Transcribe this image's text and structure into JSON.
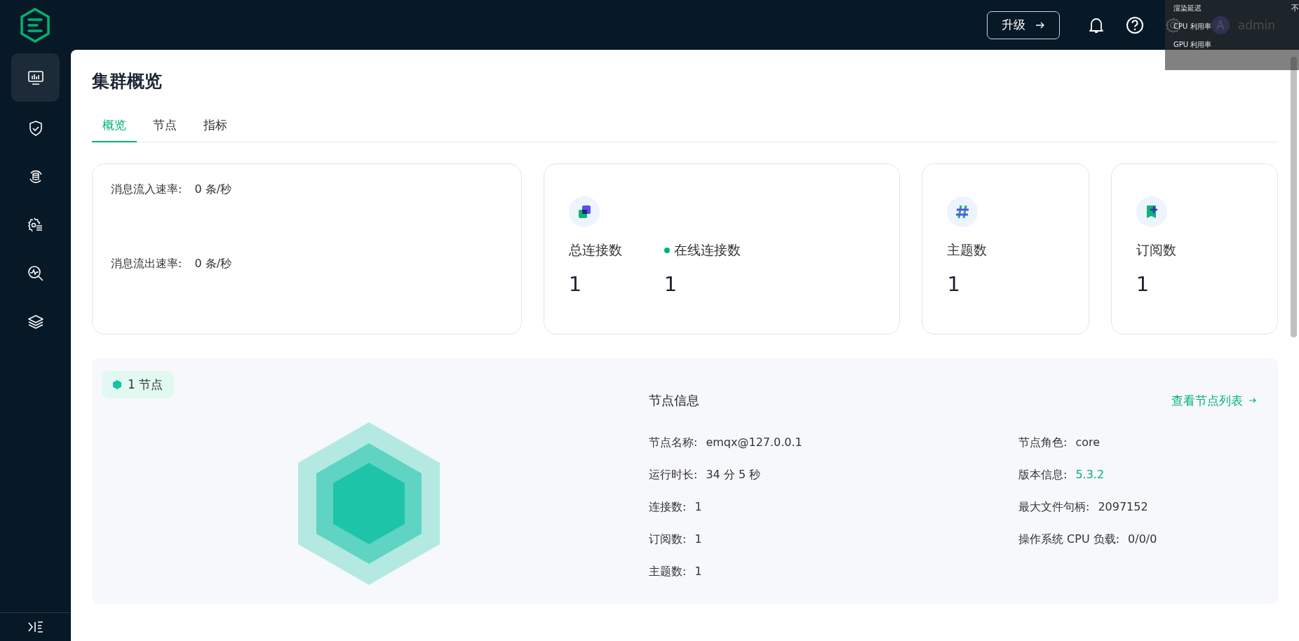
{
  "header": {
    "upgrade_button": "升级",
    "user": {
      "avatar": "A",
      "name": "admin"
    }
  },
  "overlay": {
    "items": [
      "渲染延迟",
      "CPU 利用率",
      "GPU 利用率"
    ],
    "edge_text": "不"
  },
  "sidebar": {
    "items": [
      {
        "selected": true
      },
      {
        "selected": false
      },
      {
        "selected": false
      },
      {
        "selected": false
      },
      {
        "selected": false
      },
      {
        "selected": false
      }
    ]
  },
  "page_title": "集群概览",
  "tabs": [
    {
      "label": "概览",
      "selected": true
    },
    {
      "label": "节点",
      "selected": false
    },
    {
      "label": "指标",
      "selected": false
    }
  ],
  "rates": [
    {
      "label": "消息流入速率:",
      "value": "0 条/秒"
    },
    {
      "label": "消息流出速率:",
      "value": "0 条/秒"
    }
  ],
  "stat_cards": [
    {
      "metrics": [
        {
          "label": "总连接数",
          "value": "1",
          "online": false
        },
        {
          "label": "在线连接数",
          "value": "1",
          "online": true
        }
      ]
    },
    {
      "metrics": [
        {
          "label": "主题数",
          "value": "1",
          "online": false
        }
      ]
    },
    {
      "metrics": [
        {
          "label": "订阅数",
          "value": "1",
          "online": false
        }
      ]
    }
  ],
  "node_section": {
    "badge": "1 节点",
    "title": "节点信息",
    "link": "查看节点列表",
    "fields_left": [
      {
        "label": "节点名称:",
        "value": "emqx@127.0.0.1",
        "highlight": false
      },
      {
        "label": "运行时长:",
        "value": "34 分 5 秒",
        "highlight": false
      },
      {
        "label": "连接数:",
        "value": "1",
        "highlight": false
      },
      {
        "label": "订阅数:",
        "value": "1",
        "highlight": false
      },
      {
        "label": "主题数:",
        "value": "1",
        "highlight": false
      }
    ],
    "fields_right": [
      {
        "label": "节点角色:",
        "value": "core",
        "highlight": false
      },
      {
        "label": "版本信息:",
        "value": "5.3.2",
        "highlight": true
      },
      {
        "label": "最大文件句柄:",
        "value": "2097152",
        "highlight": false
      },
      {
        "label": "操作系统 CPU 负载:",
        "value": "0/0/0",
        "highlight": false
      }
    ]
  }
}
